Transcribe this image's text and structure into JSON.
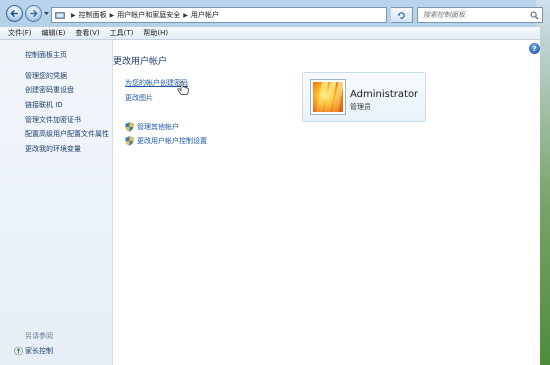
{
  "address_bar": {
    "crumbs": [
      "控制面板",
      "用户帐户和家庭安全",
      "用户帐户"
    ]
  },
  "search": {
    "placeholder": "搜索控制面板"
  },
  "menu": {
    "items": [
      "文件(F)",
      "编辑(E)",
      "查看(V)",
      "工具(T)",
      "帮助(H)"
    ]
  },
  "sidebar": {
    "items": [
      {
        "label": "控制面板主页"
      },
      {
        "label": "管理您的凭据"
      },
      {
        "label": "创建密码重设盘"
      },
      {
        "label": "链接联机 ID"
      },
      {
        "label": "管理文件加密证书"
      },
      {
        "label": "配置高级用户配置文件属性"
      },
      {
        "label": "更改我的环境变量"
      }
    ],
    "see_also": "另请参阅",
    "parental_controls": "家长控制"
  },
  "main": {
    "title": "更改用户帐户",
    "tasks": [
      {
        "label": "为您的帐户创建密码"
      },
      {
        "label": "更改图片"
      },
      {
        "label": "管理其他帐户"
      },
      {
        "label": "更改用户帐户控制设置"
      }
    ]
  },
  "account": {
    "name": "Administrator",
    "role": "管理员"
  },
  "help": {
    "glyph": "?"
  },
  "colors": {
    "link": "#1e5aa8",
    "heading": "#1e3f6b",
    "frame": "#9ec1df"
  }
}
